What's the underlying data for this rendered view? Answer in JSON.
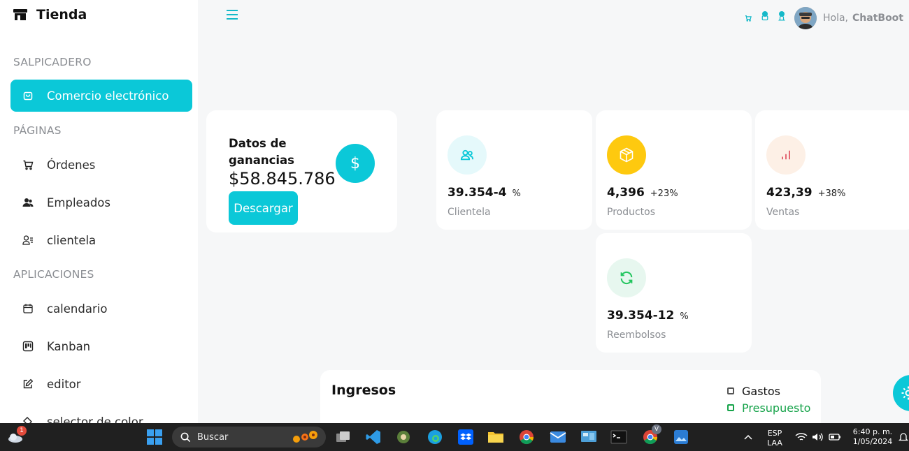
{
  "brand": {
    "name": "Tienda"
  },
  "sidebar": {
    "sections": [
      {
        "label": "SALPICADERO"
      },
      {
        "label": "PÁGINAS"
      },
      {
        "label": "APLICACIONES"
      }
    ],
    "items": [
      {
        "label": "Comercio electrónico",
        "icon": "shopping-bag-icon",
        "active": true
      },
      {
        "label": "Órdenes",
        "icon": "cart-icon"
      },
      {
        "label": "Empleados",
        "icon": "users-icon"
      },
      {
        "label": "clientela",
        "icon": "user-list-icon"
      },
      {
        "label": "calendario",
        "icon": "calendar-icon"
      },
      {
        "label": "Kanban",
        "icon": "kanban-icon"
      },
      {
        "label": "editor",
        "icon": "edit-icon"
      },
      {
        "label": "selector de color",
        "icon": "paint-bucket-icon"
      }
    ]
  },
  "topbar": {
    "greeting": "Hola,",
    "username": "ChatBoot"
  },
  "earnings": {
    "title": "Datos de ganancias",
    "amount": "$58.845.786",
    "button": "Descargar",
    "icon_symbol": "$"
  },
  "stats": [
    {
      "value": "39.354-4",
      "percent": "%",
      "label": "Clientela",
      "icon": "users-icon",
      "icon_color": "#0bc8d8",
      "bg": "#e5f9fb"
    },
    {
      "value": "4,396",
      "percent": "+23%",
      "label": "Productos",
      "icon": "box-icon",
      "icon_color": "#ffffff",
      "bg": "#fec90f"
    },
    {
      "value": "423,39",
      "percent": "+38%",
      "label": "Ventas",
      "icon": "bar-chart-icon",
      "icon_color": "#e46a76",
      "bg": "#fdf0e6"
    },
    {
      "value": "39.354-12",
      "percent": "%",
      "label": "Reembolsos",
      "icon": "refresh-icon",
      "icon_color": "#22c55e",
      "bg": "#e7f7ef"
    }
  ],
  "ingresos": {
    "title": "Ingresos",
    "legend": [
      "Gastos",
      "Presupuesto"
    ]
  },
  "taskbar": {
    "weather_badge": "1",
    "search_placeholder": "Buscar",
    "chrome_badge": "V",
    "lang": "ESP",
    "layout": "LAA",
    "time": "6:40 p. m.",
    "date": "1/05/2024"
  },
  "colors": {
    "accent": "#0bc8d8",
    "success": "#16a34a"
  }
}
